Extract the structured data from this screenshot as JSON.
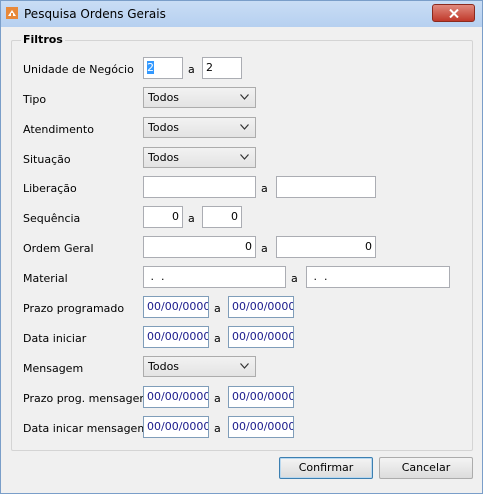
{
  "window": {
    "title": "Pesquisa Ordens Gerais"
  },
  "group": {
    "title": "Filtros"
  },
  "connector": "a",
  "fields": {
    "unidade": {
      "label": "Unidade de Negócio",
      "from": "2",
      "to": "2"
    },
    "tipo": {
      "label": "Tipo",
      "value": "Todos"
    },
    "atendimento": {
      "label": "Atendimento",
      "value": "Todos"
    },
    "situacao": {
      "label": "Situação",
      "value": "Todos"
    },
    "liberacao": {
      "label": "Liberação",
      "from": "",
      "to": ""
    },
    "sequencia": {
      "label": "Sequência",
      "from": "0",
      "to": "0"
    },
    "ordem_geral": {
      "label": "Ordem Geral",
      "from": "0",
      "to": "0"
    },
    "material": {
      "label": "Material",
      "from": " .  .",
      "to": " .  ."
    },
    "prazo_programado": {
      "label": "Prazo programado",
      "from": "00/00/0000",
      "to": "00/00/0000"
    },
    "data_iniciar": {
      "label": "Data iniciar",
      "from": "00/00/0000",
      "to": "00/00/0000"
    },
    "mensagem": {
      "label": "Mensagem",
      "value": "Todos"
    },
    "prazo_prog_mensagem": {
      "label": "Prazo prog. mensagem",
      "from": "00/00/0000",
      "to": "00/00/0000"
    },
    "data_inicar_mensagem": {
      "label": "Data inicar mensagem",
      "from": "00/00/0000",
      "to": "00/00/0000"
    }
  },
  "buttons": {
    "confirm": "Confirmar",
    "cancel": "Cancelar"
  },
  "icons": {
    "app": "app-icon",
    "close": "close-icon",
    "dropdown": "chevron-down-icon"
  },
  "colors": {
    "titlebar": "#b9d3f2",
    "close_button": "#c7463a",
    "date_text": "#1a1a8c"
  }
}
